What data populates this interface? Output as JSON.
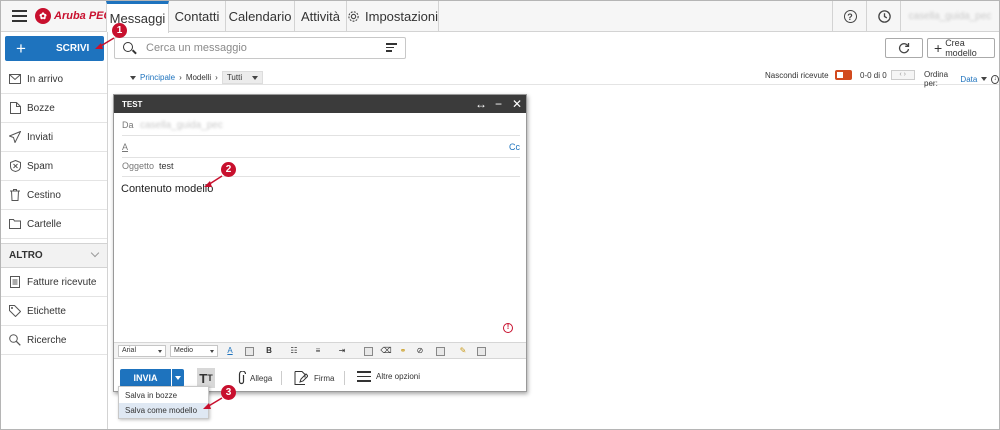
{
  "brand": {
    "name": "Aruba PEC",
    "accent": "#1e73be",
    "brand_red": "#c8102e"
  },
  "topbar": {
    "menu_icon": "hamburger-icon",
    "tabs": [
      {
        "label": "Messaggi",
        "active": true
      },
      {
        "label": "Contatti",
        "active": false
      },
      {
        "label": "Calendario",
        "active": false
      },
      {
        "label": "Attività",
        "active": false
      },
      {
        "label": "Impostazioni",
        "active": false,
        "icon": "gear-icon"
      }
    ],
    "help_icon": "question-icon",
    "history_icon": "clock-icon",
    "user": "casella_guida_pec"
  },
  "sidebar": {
    "compose_label": "SCRIVI",
    "folders": [
      {
        "label": "In arrivo",
        "icon": "inbox-icon"
      },
      {
        "label": "Bozze",
        "icon": "draft-icon"
      },
      {
        "label": "Inviati",
        "icon": "sent-icon"
      },
      {
        "label": "Spam",
        "icon": "spam-icon"
      },
      {
        "label": "Cestino",
        "icon": "trash-icon"
      },
      {
        "label": "Cartelle",
        "icon": "folder-icon"
      }
    ],
    "section_title": "ALTRO",
    "other": [
      {
        "label": "Fatture ricevute",
        "icon": "invoice-icon"
      },
      {
        "label": "Etichette",
        "icon": "tag-icon"
      },
      {
        "label": "Ricerche",
        "icon": "search-icon"
      }
    ]
  },
  "search": {
    "placeholder": "Cerca un messaggio"
  },
  "actions": {
    "new_template": "Crea modello"
  },
  "filterbar": {
    "crumb_root": "Principale",
    "crumb_folder": "Modelli",
    "crumb_filter": "Tutti",
    "hide_read_label": "Nascondi ricevute",
    "count": "0-0 di 0",
    "sort_label": "Ordina per:",
    "sort_value": "Data"
  },
  "compose": {
    "window_title": "TEST",
    "from_label": "Da",
    "from_value": "casella_guida_pec",
    "to_label": "A",
    "cc_label": "Cc",
    "subject_label": "Oggetto",
    "subject_value": "test",
    "body": "Contenuto modello",
    "font_family": "Arial",
    "font_size": "Medio",
    "send_label": "INVIA",
    "attach_label": "Allega",
    "signature_label": "Firma",
    "more_label": "Altre opzioni",
    "menu": [
      "Salva in bozze",
      "Salva come modello"
    ]
  },
  "callouts": [
    "1",
    "2",
    "3"
  ]
}
